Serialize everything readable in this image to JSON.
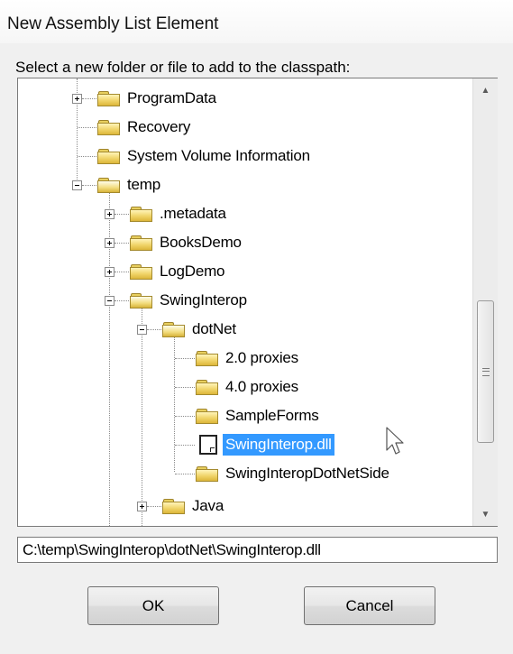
{
  "window": {
    "title": "New Assembly List Element"
  },
  "prompt": "Select a new folder or file to add to the classpath:",
  "tree": {
    "nodes": [
      {
        "label": "ProgramData"
      },
      {
        "label": "Recovery"
      },
      {
        "label": "System Volume Information"
      },
      {
        "label": "temp"
      },
      {
        "label": ".metadata"
      },
      {
        "label": "BooksDemo"
      },
      {
        "label": "LogDemo"
      },
      {
        "label": "SwingInterop"
      },
      {
        "label": "dotNet"
      },
      {
        "label": "2.0 proxies"
      },
      {
        "label": "4.0 proxies"
      },
      {
        "label": "SampleForms"
      },
      {
        "label": "SwingInterop.dll"
      },
      {
        "label": "SwingInteropDotNetSide"
      },
      {
        "label": "Java"
      }
    ]
  },
  "path_field": {
    "value": "C:\\temp\\SwingInterop\\dotNet\\SwingInterop.dll"
  },
  "buttons": {
    "ok": "OK",
    "cancel": "Cancel"
  }
}
